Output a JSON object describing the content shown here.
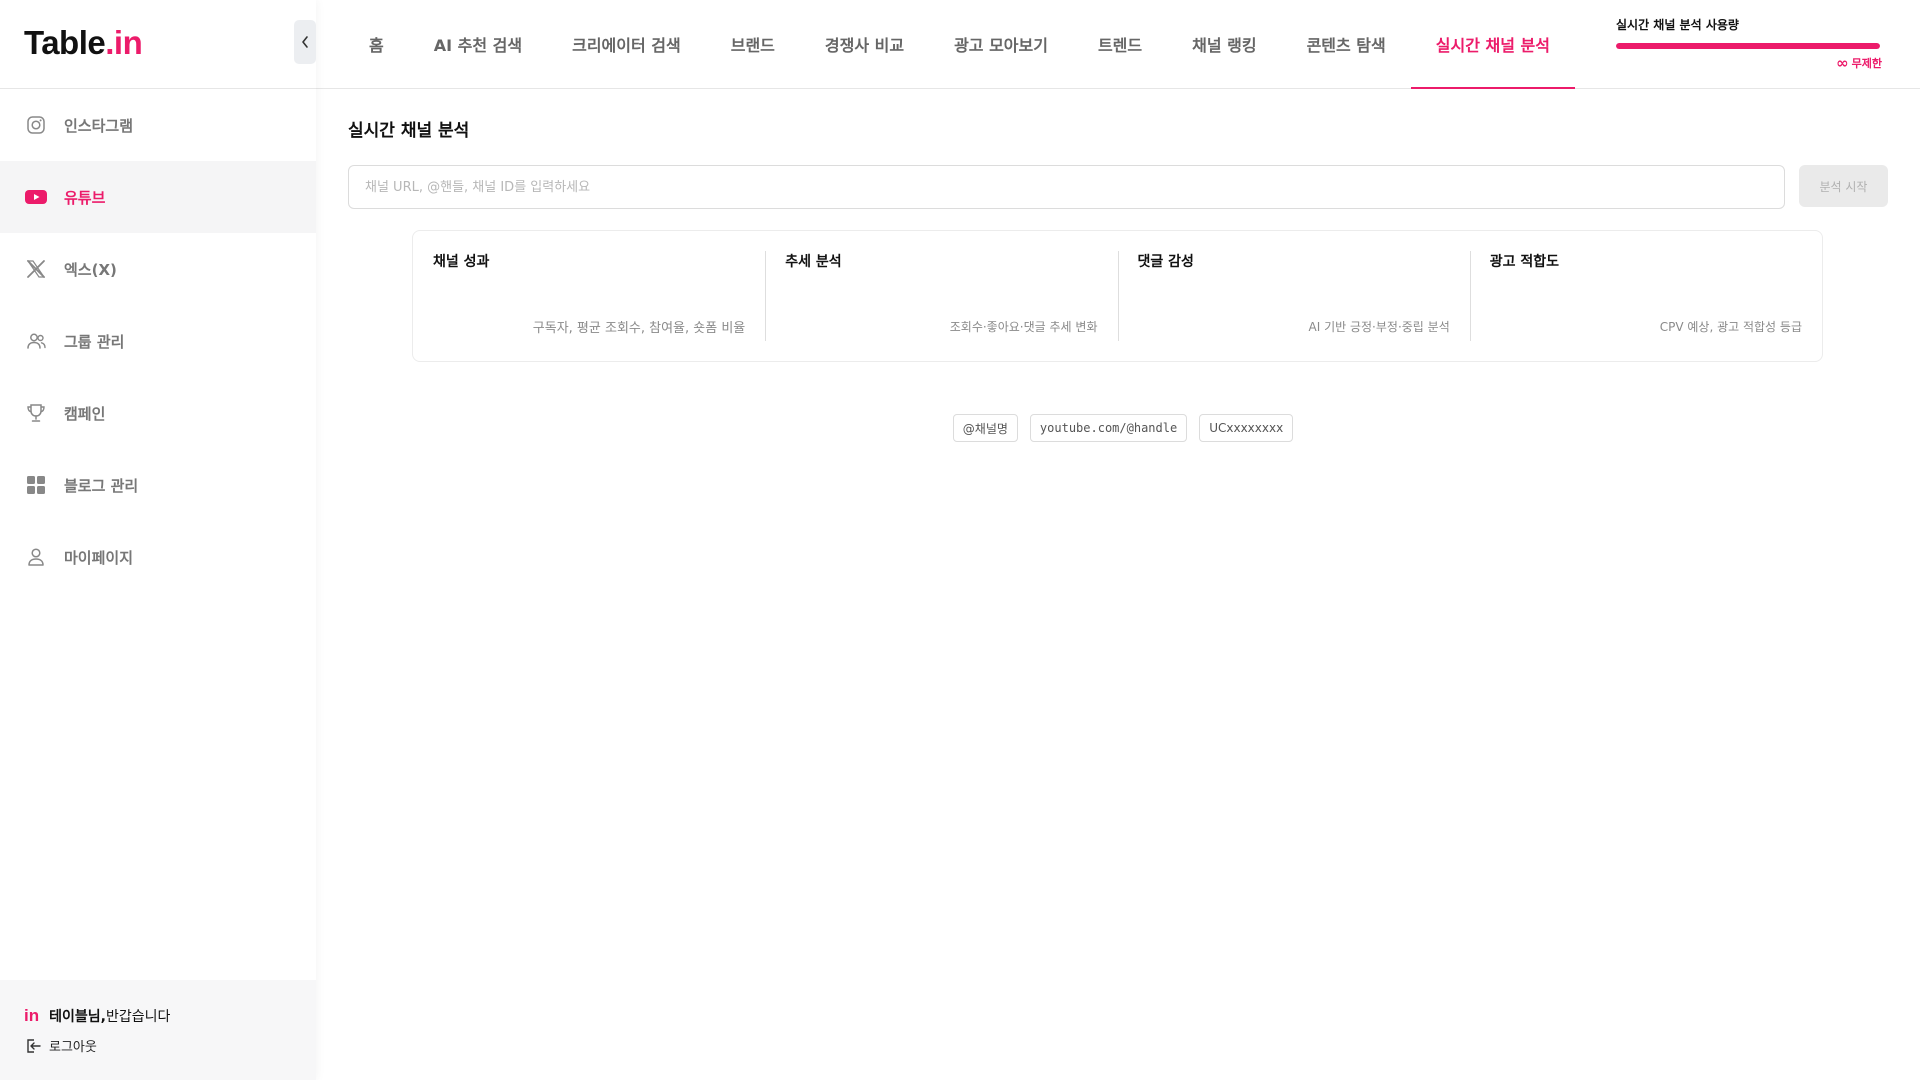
{
  "brand": {
    "logo_main": "Table",
    "logo_dot": ".",
    "logo_suffix": "in",
    "accent_color": "#ec1b6a"
  },
  "sidebar": {
    "items": [
      {
        "label": "인스타그램",
        "icon": "instagram-icon",
        "active": false
      },
      {
        "label": "유튜브",
        "icon": "youtube-icon",
        "active": true
      },
      {
        "label": "엑스(X)",
        "icon": "x-icon",
        "active": false
      },
      {
        "label": "그룹 관리",
        "icon": "group-icon",
        "active": false
      },
      {
        "label": "캠페인",
        "icon": "trophy-icon",
        "active": false
      },
      {
        "label": "블로그 관리",
        "icon": "grid-icon",
        "active": false
      },
      {
        "label": "마이페이지",
        "icon": "user-icon",
        "active": false
      }
    ],
    "footer": {
      "greeting_name": "테이블님,",
      "greeting_text": "반갑습니다",
      "logo_mark": "in",
      "logout_label": "로그아웃"
    }
  },
  "topnav": {
    "tabs": [
      {
        "label": "홈",
        "active": false
      },
      {
        "label": "AI 추천 검색",
        "active": false
      },
      {
        "label": "크리에이터 검색",
        "active": false
      },
      {
        "label": "브랜드",
        "active": false
      },
      {
        "label": "경쟁사 비교",
        "active": false
      },
      {
        "label": "광고 모아보기",
        "active": false
      },
      {
        "label": "트렌드",
        "active": false
      },
      {
        "label": "채널 랭킹",
        "active": false
      },
      {
        "label": "콘텐츠 탐색",
        "active": false
      },
      {
        "label": "실시간 채널 분석",
        "active": true
      }
    ],
    "usage": {
      "title": "실시간 채널 분석 사용량",
      "limit_label": "무제한",
      "infinity_symbol": "∞",
      "progress_fraction": 1.0
    }
  },
  "main": {
    "title": "실시간 채널 분석",
    "search": {
      "placeholder": "채널 URL, @핸들, 채널 ID를 입력하세요",
      "value": "",
      "button_label": "분석 시작"
    },
    "features": [
      {
        "title": "채널 성과",
        "desc": "구독자, 평균 조회수, 참여율, 숏폼 비율"
      },
      {
        "title": "추세 분석",
        "desc": "조회수·좋아요·댓글 추세 변화"
      },
      {
        "title": "댓글 감성",
        "desc": "AI 기반 긍정·부정·중립 분석"
      },
      {
        "title": "광고 적합도",
        "desc": "CPV 예상, 광고 적합성 등급"
      }
    ],
    "examples": [
      "@채널명",
      "youtube.com/@handle",
      "UCxxxxxxxx"
    ]
  }
}
